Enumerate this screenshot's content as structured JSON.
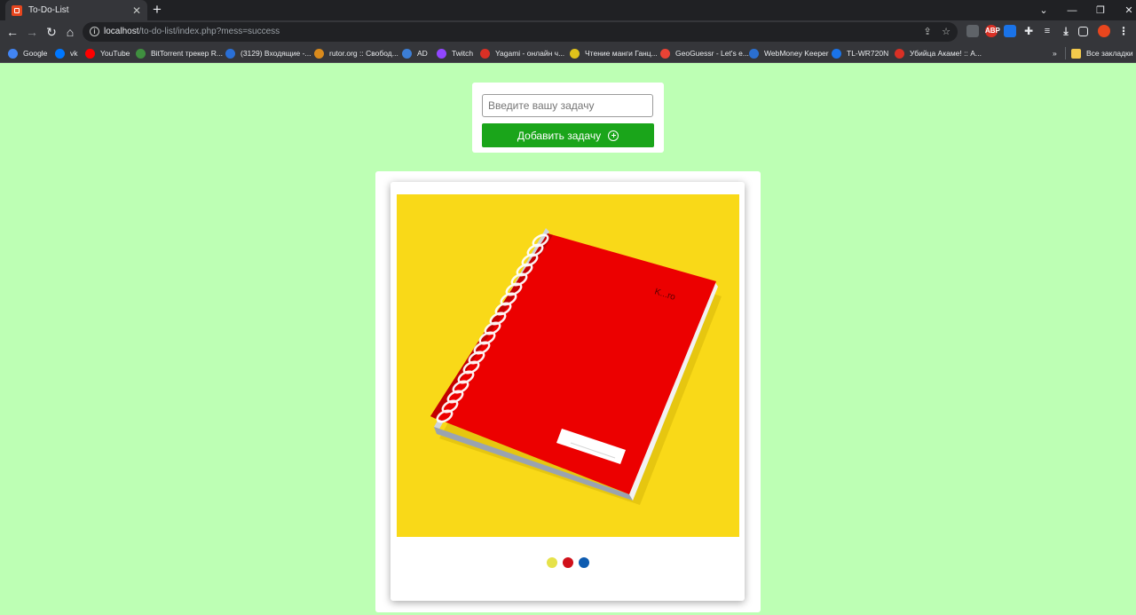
{
  "browser": {
    "tab_title": "To-Do-List",
    "new_tab": "+",
    "url_host": "localhost",
    "url_path": "/to-do-list/index.php?mess=success",
    "bookmarks": [
      {
        "label": "Google",
        "color": "#4285f4"
      },
      {
        "label": "vk",
        "color": "#0077ff"
      },
      {
        "label": "YouTube",
        "color": "#ff0000"
      },
      {
        "label": "BitTorrent трекер R...",
        "color": "#3f8f3f"
      },
      {
        "label": "(3129) Входящие -...",
        "color": "#2a6fd6"
      },
      {
        "label": "rutor.org :: Свобод...",
        "color": "#d98a1c"
      },
      {
        "label": "AD",
        "color": "#3c7ed6"
      },
      {
        "label": "Twitch",
        "color": "#9146ff"
      },
      {
        "label": "Yagami - онлайн ч...",
        "color": "#d93025"
      },
      {
        "label": "Чтение манги Ганц...",
        "color": "#e0c21b"
      },
      {
        "label": "GeoGuessr - Let's e...",
        "color": "#ea4335"
      },
      {
        "label": "WebMoney Keeper",
        "color": "#2b6fd0"
      },
      {
        "label": "TL-WR720N",
        "color": "#1a73e8"
      },
      {
        "label": "Убийца Акаме! :: А...",
        "color": "#d93025"
      }
    ],
    "bookmarks_overflow": "»",
    "all_bookmarks": "Все закладки"
  },
  "form": {
    "input_placeholder": "Введите вашу задачу",
    "input_value": "",
    "add_button_label": "Добавить задачу"
  },
  "carousel": {
    "image": "red spiral notebook on yellow background",
    "dots": [
      {
        "color": "#e6e24a"
      },
      {
        "color": "#d0101a"
      },
      {
        "color": "#0d5bb0"
      }
    ]
  },
  "colors": {
    "page_bg": "#bdffb4",
    "button_green": "#1aa51a",
    "image_bg": "#f9d918",
    "notebook_red": "#ec0000"
  }
}
